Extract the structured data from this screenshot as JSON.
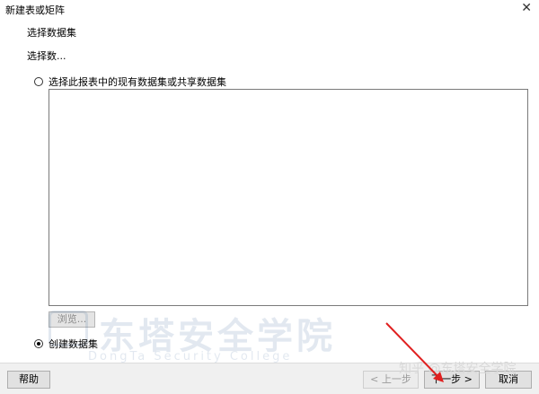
{
  "window": {
    "title": "新建表或矩阵",
    "close_glyph": "✕"
  },
  "dialog": {
    "section_title": "选择数据集",
    "sub_title": "选择数...",
    "option_existing": {
      "label": "选择此报表中的现有数据集或共享数据集",
      "selected": false
    },
    "browse_label": "浏览...",
    "option_create": {
      "label": "创建数据集",
      "selected": true
    }
  },
  "footer": {
    "help_label": "帮助",
    "prev_label": "< 上一步",
    "next_label": "下一步 >",
    "cancel_label": "取消"
  },
  "watermark": {
    "cn": "东塔安全学院",
    "en": "DongTa Security College",
    "zhihu": "知乎 @东塔安全学院"
  },
  "colors": {
    "annotation_arrow": "#e02020",
    "watermark": "#1a4e8a"
  }
}
